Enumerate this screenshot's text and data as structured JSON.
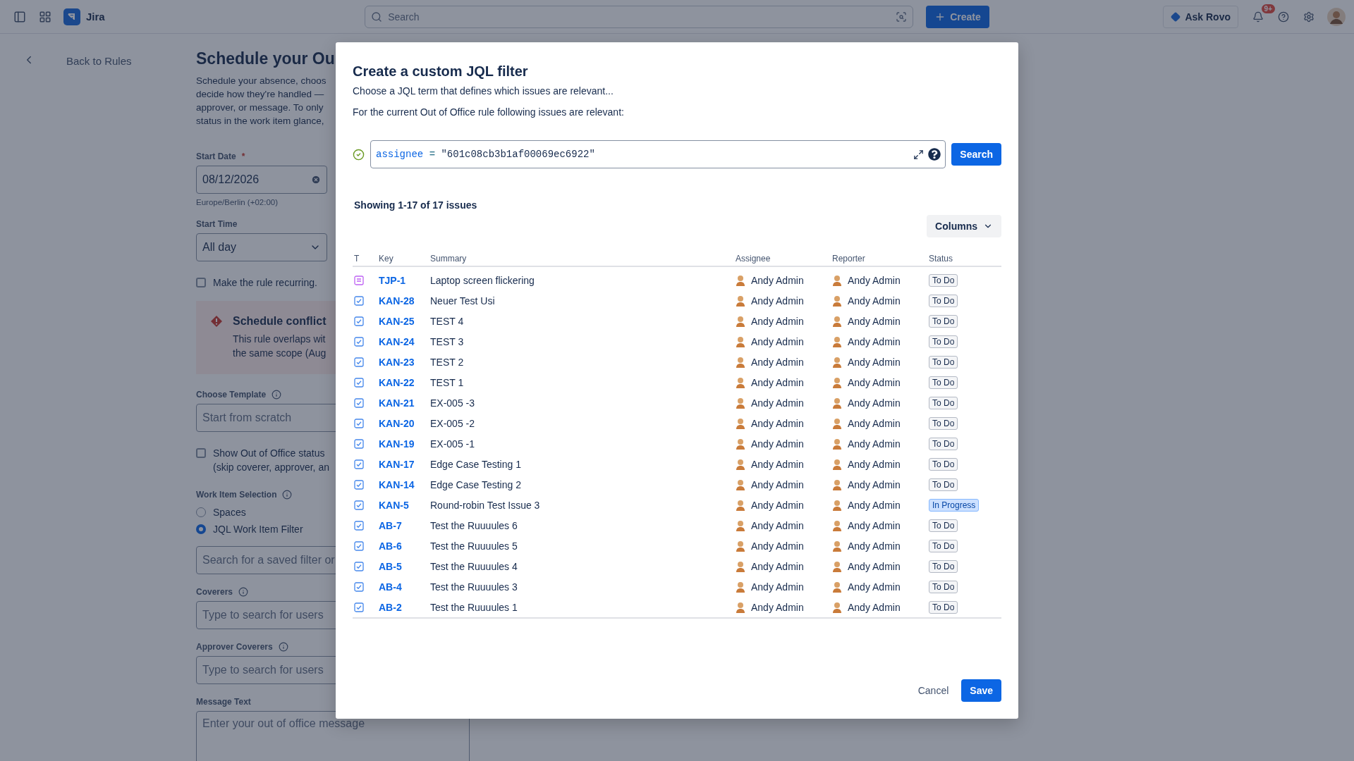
{
  "top_bar": {
    "app_name": "Jira",
    "search": {
      "placeholder": "Search"
    },
    "create_button": "Create",
    "ask_button": "Ask Rovo",
    "notification_badge": "9+"
  },
  "page": {
    "back_link": "Back to Rules",
    "title": "Schedule your Ou",
    "description_lines": [
      "Schedule your absence, choos",
      "decide how they're handled —",
      "approver, or message. To only",
      "status in the work item glance,"
    ],
    "fields": [
      {
        "kind": "date",
        "label": "Start Date",
        "required_mark": "*",
        "value": "08/12/2026",
        "hint": "Europe/Berlin (+02:00)"
      },
      {
        "kind": "select",
        "label": "Start Time",
        "value": "All day"
      },
      {
        "kind": "checkbox",
        "lines": [
          "Make the rule recurring."
        ],
        "checked": false
      },
      {
        "kind": "alert",
        "title": "Schedule conflict",
        "lines": [
          "This rule overlaps wit",
          "the same scope (Aug"
        ]
      },
      {
        "kind": "text",
        "label": "Choose Template",
        "info": true,
        "placeholder": "Start from scratch"
      },
      {
        "kind": "checkbox",
        "lines": [
          "Show Out of Office status",
          "(skip coverer, approver, an"
        ],
        "checked": false
      },
      {
        "kind": "radio",
        "label": "Work Item Selection",
        "info": true,
        "options": [
          {
            "label": "Spaces",
            "selected": false
          },
          {
            "label": "JQL Work Item Filter",
            "selected": true
          }
        ]
      },
      {
        "kind": "text",
        "placeholder": "Search for a saved filter or"
      },
      {
        "kind": "text",
        "label": "Coverers",
        "info": true,
        "placeholder": "Type to search for users"
      },
      {
        "kind": "text",
        "label": "Approver Coverers",
        "info": true,
        "placeholder": "Type to search for users"
      },
      {
        "kind": "textarea",
        "label": "Message Text",
        "placeholder": "Enter your out of office message"
      }
    ]
  },
  "dialog": {
    "title": "Create a custom JQL filter",
    "subtitle": "Choose a JQL term that defines which issues are relevant...",
    "scope_text": "For the current Out of Office rule following issues are relevant:",
    "jql": {
      "valid": true,
      "field": "assignee",
      "operator": "=",
      "value": "\"601c08cb3b1af00069ec6922\""
    },
    "search_button": "Search",
    "result_count": "Showing 1-17 of 17 issues",
    "columns_button": "Columns",
    "table": {
      "columns": [
        "T",
        "Key",
        "Summary",
        "Assignee",
        "Reporter",
        "Status"
      ],
      "rows": [
        {
          "kind": "request",
          "key": "TJP-1",
          "summary": "Laptop screen flickering",
          "assignee": "Andy Admin",
          "reporter": "Andy Admin",
          "status": "To Do",
          "color": "#f4f5f7"
        },
        {
          "kind": "task",
          "key": "KAN-28",
          "summary": "Neuer Test Usi",
          "assignee": "Andy Admin",
          "reporter": "Andy Admin",
          "status": "To Do",
          "color": "#f4f5f7"
        },
        {
          "kind": "task",
          "key": "KAN-25",
          "summary": "TEST 4",
          "assignee": "Andy Admin",
          "reporter": "Andy Admin",
          "status": "To Do",
          "color": "#f4f5f7"
        },
        {
          "kind": "task",
          "key": "KAN-24",
          "summary": "TEST 3",
          "assignee": "Andy Admin",
          "reporter": "Andy Admin",
          "status": "To Do",
          "color": "#f4f5f7"
        },
        {
          "kind": "task",
          "key": "KAN-23",
          "summary": "TEST 2",
          "assignee": "Andy Admin",
          "reporter": "Andy Admin",
          "status": "To Do",
          "color": "#f4f5f7"
        },
        {
          "kind": "task",
          "key": "KAN-22",
          "summary": "TEST 1",
          "assignee": "Andy Admin",
          "reporter": "Andy Admin",
          "status": "To Do",
          "color": "#f4f5f7"
        },
        {
          "kind": "task",
          "key": "KAN-21",
          "summary": "EX-005 -3",
          "assignee": "Andy Admin",
          "reporter": "Andy Admin",
          "status": "To Do",
          "color": "#f4f5f7"
        },
        {
          "kind": "task",
          "key": "KAN-20",
          "summary": "EX-005 -2",
          "assignee": "Andy Admin",
          "reporter": "Andy Admin",
          "status": "To Do",
          "color": "#f4f5f7"
        },
        {
          "kind": "task",
          "key": "KAN-19",
          "summary": "EX-005 -1",
          "assignee": "Andy Admin",
          "reporter": "Andy Admin",
          "status": "To Do",
          "color": "#f4f5f7"
        },
        {
          "kind": "task",
          "key": "KAN-17",
          "summary": "Edge Case Testing 1",
          "assignee": "Andy Admin",
          "reporter": "Andy Admin",
          "status": "To Do",
          "color": "#f4f5f7"
        },
        {
          "kind": "task",
          "key": "KAN-14",
          "summary": "Edge Case Testing 2",
          "assignee": "Andy Admin",
          "reporter": "Andy Admin",
          "status": "To Do",
          "color": "#f4f5f7"
        },
        {
          "kind": "task",
          "key": "KAN-5",
          "summary": "Round-robin Test Issue 3",
          "assignee": "Andy Admin",
          "reporter": "Andy Admin",
          "status": "In Progress",
          "color": "#cce0ff"
        },
        {
          "kind": "task",
          "key": "AB-7",
          "summary": "Test the Ruuuules 6",
          "assignee": "Andy Admin",
          "reporter": "Andy Admin",
          "status": "To Do",
          "color": "#f4f5f7"
        },
        {
          "kind": "task",
          "key": "AB-6",
          "summary": "Test the Ruuuules 5",
          "assignee": "Andy Admin",
          "reporter": "Andy Admin",
          "status": "To Do",
          "color": "#f4f5f7"
        },
        {
          "kind": "task",
          "key": "AB-5",
          "summary": "Test the Ruuuules 4",
          "assignee": "Andy Admin",
          "reporter": "Andy Admin",
          "status": "To Do",
          "color": "#f4f5f7"
        },
        {
          "kind": "task",
          "key": "AB-4",
          "summary": "Test the Ruuuules 3",
          "assignee": "Andy Admin",
          "reporter": "Andy Admin",
          "status": "To Do",
          "color": "#f4f5f7"
        },
        {
          "kind": "task",
          "key": "AB-2",
          "summary": "Test the Ruuuules 1",
          "assignee": "Andy Admin",
          "reporter": "Andy Admin",
          "status": "To Do",
          "color": "#f4f5f7"
        }
      ]
    },
    "cancel_button": "Cancel",
    "save_button": "Save"
  }
}
